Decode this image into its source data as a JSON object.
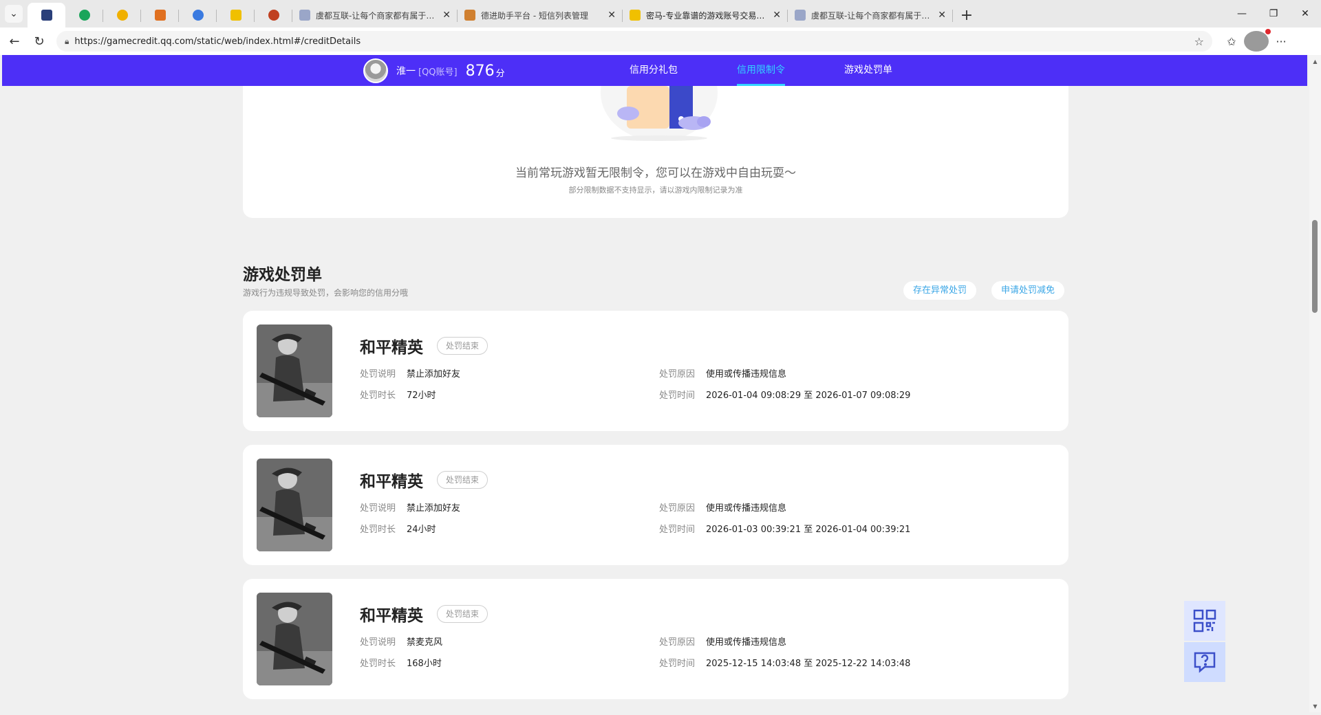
{
  "browser": {
    "tabs": [
      {
        "title": "",
        "favicon_color": "#2a3f7a",
        "pinned": true,
        "active": true
      },
      {
        "title": "",
        "favicon_color": "#1aa55a",
        "pinned": true
      },
      {
        "title": "",
        "favicon_color": "#f0b000",
        "pinned": true
      },
      {
        "title": "",
        "favicon_color": "#e07020",
        "pinned": true
      },
      {
        "title": "",
        "favicon_color": "#3a7ae0",
        "pinned": true
      },
      {
        "title": "",
        "favicon_color": "#f0c000",
        "pinned": true
      },
      {
        "title": "",
        "favicon_color": "#c04020",
        "pinned": true
      },
      {
        "title": "虞都互联-让每个商家都有属于自己",
        "favicon_color": "#9aa6c8"
      },
      {
        "title": "德进助手平台 - 短信列表管理",
        "favicon_color": "#d08030"
      },
      {
        "title": "密马-专业靠谱的游戏账号交易平台",
        "favicon_color": "#f0c000"
      },
      {
        "title": "虞都互联-让每个商家都有属于自己",
        "favicon_color": "#9aa6c8"
      }
    ],
    "new_tab_label": "+",
    "url": "https://gamecredit.qq.com/static/web/index.html#/creditDetails"
  },
  "header": {
    "user_name": "淮一",
    "account_type": "[QQ账号]",
    "score": "876",
    "score_unit": "分",
    "nav": [
      {
        "label": "信用分礼包",
        "active": false
      },
      {
        "label": "信用限制令",
        "active": true
      },
      {
        "label": "游戏处罚单",
        "active": false
      }
    ]
  },
  "limits": {
    "message": "当前常玩游戏暂无限制令，您可以在游戏中自由玩耍～",
    "note": "部分限制数据不支持显示，请以游戏内限制记录为准"
  },
  "penalties": {
    "title": "游戏处罚单",
    "subtitle": "游戏行为违规导致处罚，会影响您的信用分哦",
    "action_abnormal": "存在异常处罚",
    "action_reduce": "申请处罚减免",
    "labels": {
      "desc": "处罚说明",
      "reason": "处罚原因",
      "duration": "处罚时长",
      "time": "处罚时间"
    },
    "items": [
      {
        "game": "和平精英",
        "status": "处罚结束",
        "desc": "禁止添加好友",
        "reason": "使用或传播违规信息",
        "duration": "72小时",
        "time": "2026-01-04 09:08:29 至 2026-01-07 09:08:29"
      },
      {
        "game": "和平精英",
        "status": "处罚结束",
        "desc": "禁止添加好友",
        "reason": "使用或传播违规信息",
        "duration": "24小时",
        "time": "2026-01-03 00:39:21 至 2026-01-04 00:39:21"
      },
      {
        "game": "和平精英",
        "status": "处罚结束",
        "desc": "禁麦克风",
        "reason": "使用或传播违规信息",
        "duration": "168小时",
        "time": "2025-12-15 14:03:48 至 2025-12-22 14:03:48"
      }
    ]
  },
  "colors": {
    "nav_bg": "#4d2ff7",
    "nav_active": "#33d3ff",
    "pill_text": "#3aa6e6"
  }
}
